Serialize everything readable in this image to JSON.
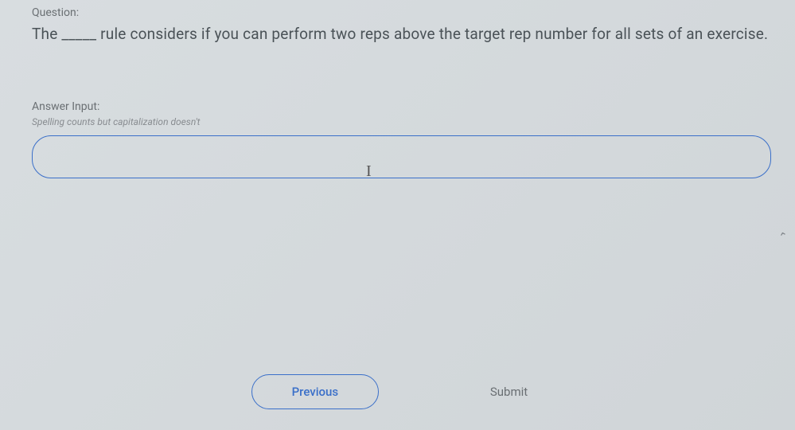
{
  "question": {
    "label": "Question:",
    "text": "The _____ rule considers if you can perform two reps above the target rep number for all sets of an exercise."
  },
  "answer": {
    "label": "Answer Input:",
    "hint": "Spelling counts but capitalization doesn't",
    "value": "",
    "placeholder": ""
  },
  "buttons": {
    "previous": "Previous",
    "submit": "Submit"
  }
}
